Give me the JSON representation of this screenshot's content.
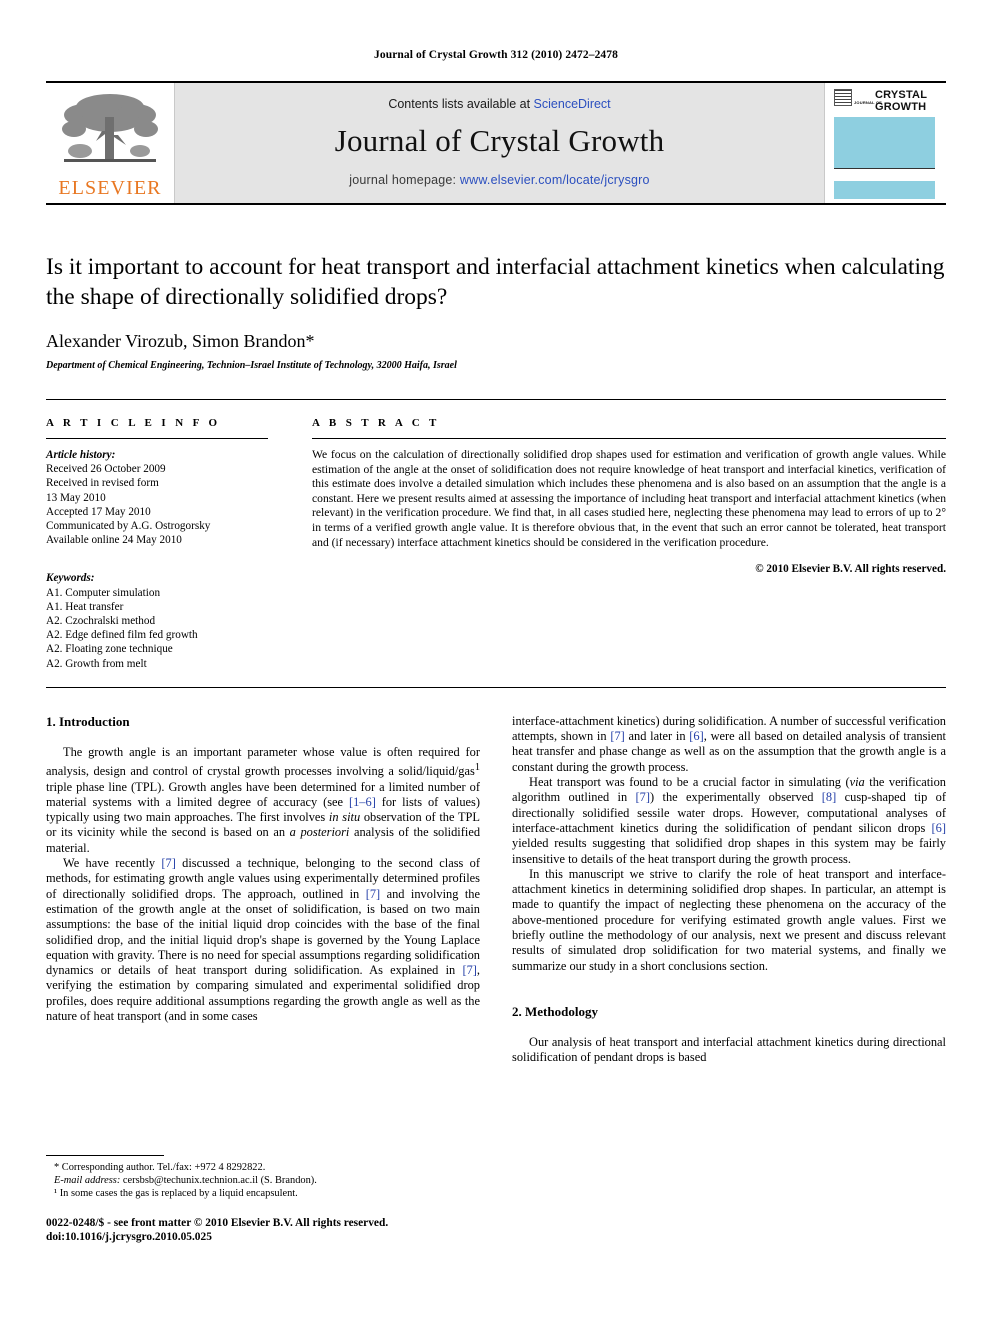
{
  "running_head": "Journal of Crystal Growth 312 (2010) 2472–2478",
  "masthead": {
    "publisher_name": "ELSEVIER",
    "contents_prefix": "Contents lists available at ",
    "contents_link": "ScienceDirect",
    "journal_title": "Journal of Crystal Growth",
    "homepage_prefix": "journal homepage: ",
    "homepage_url": "www.elsevier.com/locate/jcrysgro",
    "cover": {
      "journal_of": "JOURNAL OF",
      "title_line1": "CRYSTAL",
      "title_line2": "GROWTH"
    },
    "accent_color": "#2b4fbf",
    "cover_color": "#8ecfe0",
    "logo_color": "#E87722"
  },
  "article": {
    "title": "Is it important to account for heat transport and interfacial attachment kinetics when calculating the shape of directionally solidified drops?",
    "authors": "Alexander Virozub, Simon Brandon*",
    "affiliation": "Department of Chemical Engineering, Technion–Israel Institute of Technology, 32000 Haifa, Israel"
  },
  "article_info": {
    "label": "A R T I C L E   I N F O",
    "history_heading": "Article history:",
    "history": [
      "Received 26 October 2009",
      "Received in revised form",
      "13 May 2010",
      "Accepted 17 May 2010",
      "Communicated by A.G. Ostrogorsky",
      "Available online 24 May 2010"
    ],
    "keywords_heading": "Keywords:",
    "keywords": [
      "A1. Computer simulation",
      "A1. Heat transfer",
      "A2. Czochralski method",
      "A2. Edge defined film fed growth",
      "A2. Floating zone technique",
      "A2. Growth from melt"
    ]
  },
  "abstract": {
    "label": "A B S T R A C T",
    "text": "We focus on the calculation of directionally solidified drop shapes used for estimation and verification of growth angle values. While estimation of the angle at the onset of solidification does not require knowledge of heat transport and interfacial kinetics, verification of this estimate does involve a detailed simulation which includes these phenomena and is also based on an assumption that the angle is a constant. Here we present results aimed at assessing the importance of including heat transport and interfacial attachment kinetics (when relevant) in the verification procedure. We find that, in all cases studied here, neglecting these phenomena may lead to errors of up to 2° in terms of a verified growth angle value. It is therefore obvious that, in the event that such an error cannot be tolerated, heat transport and (if necessary) interface attachment kinetics should be considered in the verification procedure.",
    "copyright": "© 2010 Elsevier B.V. All rights reserved."
  },
  "sections": {
    "introduction_heading": "1. Introduction",
    "methodology_heading": "2. Methodology"
  },
  "body": {
    "left": [
      "The growth angle is an important parameter whose value is often required for analysis, design and control of crystal growth processes involving a solid/liquid/gas¹ triple phase line (TPL). Growth angles have been determined for a limited number of material systems with a limited degree of accuracy (see [1–6] for lists of values) typically using two main approaches. The first involves in situ observation of the TPL or its vicinity while the second is based on an a posteriori analysis of the solidified material.",
      "We have recently [7] discussed a technique, belonging to the second class of methods, for estimating growth angle values using experimentally determined profiles of directionally solidified drops. The approach, outlined in [7] and involving the estimation of the growth angle at the onset of solidification, is based on two main assumptions: the base of the initial liquid drop coincides with the base of the final solidified drop, and the initial liquid drop's shape is governed by the Young Laplace equation with gravity. There is no need for special assumptions regarding solidification dynamics or details of heat transport during solidification. As explained in [7], verifying the estimation by comparing simulated and experimental solidified drop profiles, does require additional assumptions regarding the growth angle as well as the nature of heat transport (and in some cases"
    ],
    "right": [
      "interface-attachment kinetics) during solidification. A number of successful verification attempts, shown in [7] and later in [6], were all based on detailed analysis of transient heat transfer and phase change as well as on the assumption that the growth angle is a constant during the growth process.",
      "Heat transport was found to be a crucial factor in simulating (via the verification algorithm outlined in [7]) the experimentally observed [8] cusp-shaped tip of directionally solidified sessile water drops. However, computational analyses of interface-attachment kinetics during the solidification of pendant silicon drops [6] yielded results suggesting that solidified drop shapes in this system may be fairly insensitive to details of the heat transport during the growth process.",
      "In this manuscript we strive to clarify the role of heat transport and interface-attachment kinetics in determining solidified drop shapes. In particular, an attempt is made to quantify the impact of neglecting these phenomena on the accuracy of the above-mentioned procedure for verifying estimated growth angle values. First we briefly outline the methodology of our analysis, next we present and discuss relevant results of simulated drop solidification for two material systems, and finally we summarize our study in a short conclusions section.",
      "Our analysis of heat transport and interfacial attachment kinetics during directional solidification of pendant drops is based"
    ]
  },
  "footnotes": {
    "corresponding": "* Corresponding author. Tel./fax: +972 4 8292822.",
    "email": "E-mail address: cersbsb@techunix.technion.ac.il (S. Brandon).",
    "note1": "¹ In some cases the gas is replaced by a liquid encapsulent."
  },
  "bottom_matter": {
    "issn_line": "0022-0248/$ - see front matter © 2010 Elsevier B.V. All rights reserved.",
    "doi_line": "doi:10.1016/j.jcrysgro.2010.05.025"
  }
}
